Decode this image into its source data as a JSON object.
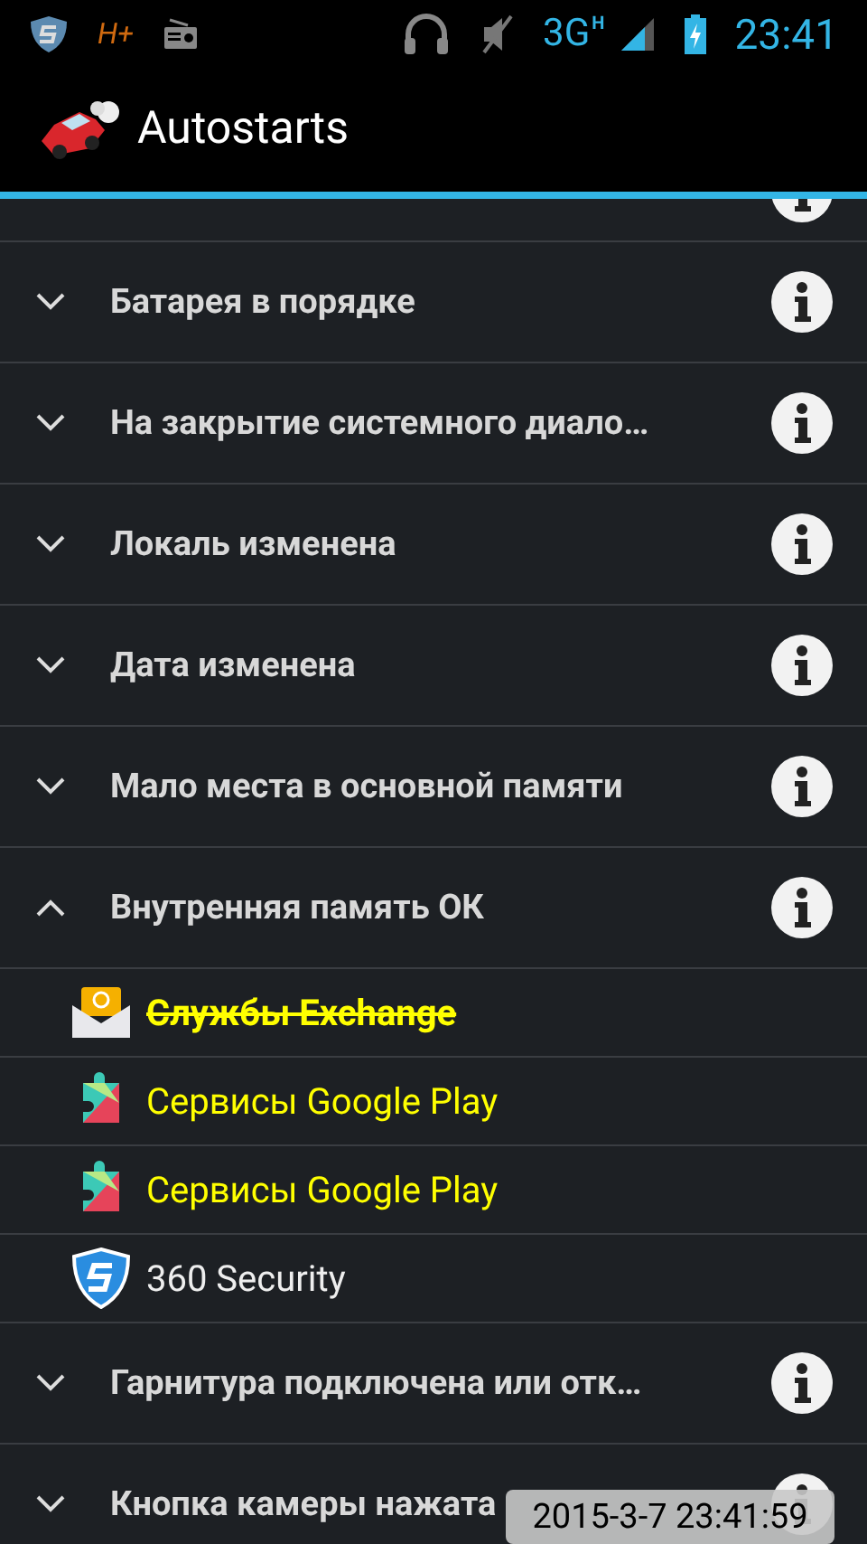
{
  "status_bar": {
    "network_label": "H+",
    "signal_type": "3G",
    "signal_sub": "H",
    "time": "23:41"
  },
  "action_bar": {
    "title": "Autostarts"
  },
  "events": [
    {
      "label": "Батарея в порядке",
      "expanded": false
    },
    {
      "label": "На закрытие системного диало…",
      "expanded": false
    },
    {
      "label": "Локаль изменена",
      "expanded": false
    },
    {
      "label": "Дата изменена",
      "expanded": false
    },
    {
      "label": "Мало места в основной памяти",
      "expanded": false
    },
    {
      "label": "Внутренняя память ОК",
      "expanded": true,
      "children": [
        {
          "name": "Службы Exchange",
          "kind": "mail",
          "highlighted": true,
          "disabled": true
        },
        {
          "name": "Сервисы Google Play",
          "kind": "puzzle",
          "highlighted": true,
          "disabled": false
        },
        {
          "name": "Сервисы Google Play",
          "kind": "puzzle",
          "highlighted": true,
          "disabled": false
        },
        {
          "name": "360 Security",
          "kind": "shield",
          "highlighted": false,
          "disabled": false
        }
      ]
    },
    {
      "label": "Гарнитура подключена или отк…",
      "expanded": false
    },
    {
      "label": "Кнопка камеры нажата",
      "expanded": false
    }
  ],
  "timestamp_overlay": "2015-3-7 23:41:59"
}
